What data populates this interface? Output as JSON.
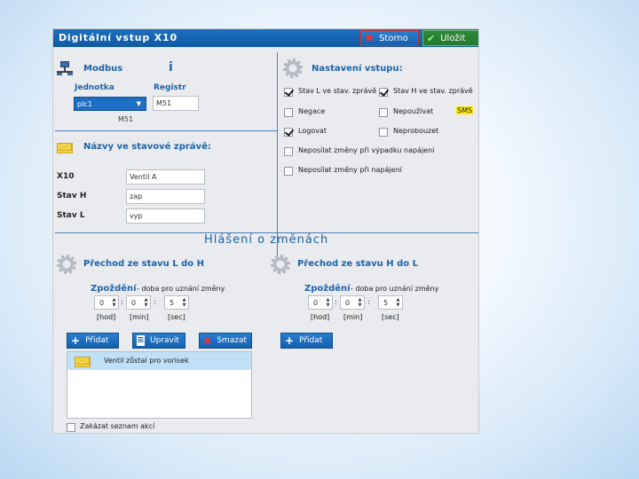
{
  "window": {
    "title": "Digitální vstup X10",
    "cancel_label": "Storno",
    "save_label": "Uložit"
  },
  "modbus": {
    "header": "Modbus",
    "unit_label": "Jednotka",
    "unit_value": "plc1",
    "register_label": "Registr",
    "register_value": "M51",
    "register_display": "M51"
  },
  "messages": {
    "header": "Názvy ve stavové zprávě:",
    "rows": [
      {
        "label": "X10",
        "value": "Ventil A"
      },
      {
        "label": "Stav H",
        "value": "zap"
      },
      {
        "label": "Stav L",
        "value": "vyp"
      }
    ]
  },
  "settings": {
    "header": "Nastavení vstupu:",
    "options": [
      {
        "label": "Stav L ve stav. zprávě",
        "checked": true
      },
      {
        "label": "Stav H ve stav. zprávě",
        "checked": true
      },
      {
        "label": "Negace",
        "checked": false
      },
      {
        "label": "Nepoužívat",
        "checked": false
      },
      {
        "label": "Logovat",
        "checked": true
      },
      {
        "label": "Neprobouzet",
        "checked": false
      },
      {
        "label": "Neposílat změny při výpadku napájení",
        "checked": false
      },
      {
        "label": "Neposílat změny při napájení",
        "checked": false
      }
    ],
    "sms_badge": "SMS"
  },
  "notifications": {
    "header": "Hlášení o změnách",
    "left": {
      "title": "Přechod ze stavu L do H",
      "delay_label": "Zpoždění",
      "delay_hint": "- doba pro uznání změny",
      "hours": "0",
      "minutes": "0",
      "seconds": "5",
      "unit_h": "[hod]",
      "unit_m": "[min]",
      "unit_s": "[sec]",
      "add_label": "Přidat",
      "edit_label": "Upravit",
      "delete_label": "Smazat",
      "list": [
        "Ventil zůstal pro vorisek"
      ]
    },
    "right": {
      "title": "Přechod ze stavu H do L",
      "delay_label": "Zpoždění",
      "delay_hint": "- doba pro uznání změny",
      "hours": "0",
      "minutes": "0",
      "seconds": "5",
      "unit_h": "[hod]",
      "unit_m": "[min]",
      "unit_s": "[sec]",
      "add_label": "Přidat"
    },
    "disable_list_label": "Zakázat seznam akcí"
  },
  "colors": {
    "title_bar": "#0e59a3",
    "accent_text": "#1e63a8",
    "list_selection": "#bfe0f7",
    "sms_badge": "#ffe600"
  }
}
